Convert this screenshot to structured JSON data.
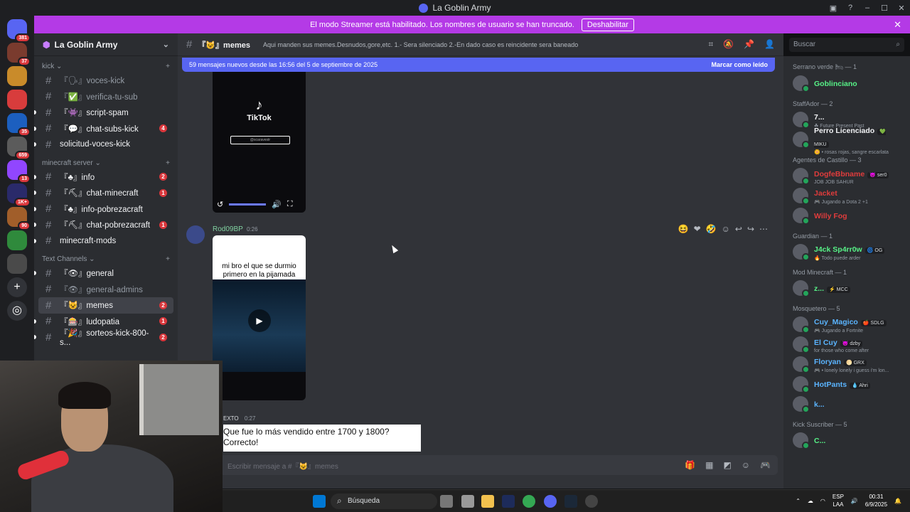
{
  "window": {
    "title": "La Goblin Army"
  },
  "servers": [
    {
      "icon": "discord-home-icon",
      "badge": "381",
      "color": "#5865f2"
    },
    {
      "icon": "server-icon",
      "badge": "37",
      "color": "#7a3b2e"
    },
    {
      "icon": "server-icon",
      "badge": "",
      "color": "#c98b2a"
    },
    {
      "icon": "server-icon",
      "badge": "",
      "color": "#d83c3c"
    },
    {
      "icon": "server-icon",
      "badge": "35",
      "color": "#1c5fbf"
    },
    {
      "icon": "server-icon",
      "badge": "659",
      "color": "#5b5b5b"
    },
    {
      "icon": "server-icon",
      "badge": "13",
      "color": "#9146ff"
    },
    {
      "icon": "server-icon",
      "badge": "1K+",
      "color": "#2a2a6a"
    },
    {
      "icon": "server-icon",
      "badge": "90",
      "color": "#a15e2a"
    },
    {
      "icon": "server-icon",
      "badge": "",
      "color": "#2f8a3c"
    },
    {
      "icon": "server-icon",
      "badge": "",
      "color": "#4a4a4a"
    }
  ],
  "banner": {
    "text": "El modo Streamer está habilitado. Los nombres de usuario se han truncado.",
    "button": "Deshabilitar",
    "close": "✕",
    "color": "#b43ae6"
  },
  "server": {
    "name": "La Goblin Army"
  },
  "categories": [
    {
      "label": "kick",
      "channels": [
        {
          "name": "『🗣』voces-kick",
          "unread": false,
          "count": ""
        },
        {
          "name": "『✅』verifica-tu-sub",
          "unread": false,
          "count": ""
        },
        {
          "name": "『👾』script-spam",
          "unread": true,
          "count": ""
        },
        {
          "name": "『💬』chat-subs-kick",
          "unread": true,
          "count": "4"
        },
        {
          "name": "solicitud-voces-kick",
          "unread": true,
          "count": ""
        }
      ]
    },
    {
      "label": "minecraft server",
      "channels": [
        {
          "name": "『♣』info",
          "unread": true,
          "count": "2"
        },
        {
          "name": "『⛏』chat-minecraft",
          "unread": true,
          "count": "1"
        },
        {
          "name": "『♣』info-pobrezacraft",
          "unread": true,
          "count": ""
        },
        {
          "name": "『⛏』chat-pobrezacraft",
          "unread": true,
          "count": "1"
        },
        {
          "name": "minecraft-mods",
          "unread": true,
          "count": ""
        }
      ]
    },
    {
      "label": "Text Channels",
      "channels": [
        {
          "name": "『👁』general",
          "unread": true,
          "count": ""
        },
        {
          "name": "『👁』general-admins",
          "unread": false,
          "count": ""
        },
        {
          "name": "『😺』memes",
          "unread": false,
          "count": "2",
          "active": true
        },
        {
          "name": "『🎰』ludopatia",
          "unread": true,
          "count": "1"
        },
        {
          "name": "『🎉』sorteos-kick-800-s...",
          "unread": true,
          "count": "2"
        }
      ]
    }
  ],
  "header": {
    "channel": "『😺』memes",
    "topic": "Aqui manden sus memes.Desnudos,gore,etc. 1.- Sera silenciado 2.-En dado caso es reincidente sera baneado",
    "search_placeholder": "Buscar"
  },
  "newbar": {
    "text": "59 mensajes nuevos desde las 16:56 del 5 de septiembre de 2025",
    "mark": "Marcar como leído"
  },
  "video1": {
    "brand": "TikTok",
    "handle": "@scaravestr"
  },
  "message2": {
    "author": "Rod09BP",
    "time": "0:26",
    "video_caption": "mi bro el que se durmio primero en la pijamada"
  },
  "message3": {
    "tag": "EXTO",
    "time": "0:27",
    "line1": "Que fue lo más vendido entre 1700 y 1800?",
    "line2": "Correcto!"
  },
  "composer": {
    "placeholder": "Escribir mensaje a #『😺』memes"
  },
  "member_groups": [
    {
      "label": "Serrano verde 🛏 — 1",
      "members": [
        {
          "name": "Goblinciano",
          "color": "#57f287",
          "status": "",
          "tag": ""
        }
      ]
    },
    {
      "label": "StaffAdor — 2",
      "members": [
        {
          "name": "7...",
          "color": "#f2f3f5",
          "status": "☘ Future Present Past",
          "tag": ""
        },
        {
          "name": "Perro Licenciado",
          "color": "#f2f3f5",
          "status": "🌼 • rosas rojas, sangre escarlata",
          "tag": "💚 MIKU"
        }
      ]
    },
    {
      "label": "Agentes de Castillo — 3",
      "members": [
        {
          "name": "DogfeBbname",
          "color": "#e03c3c",
          "status": "JOB JOB SAHUR",
          "tag": "😈 ser0"
        },
        {
          "name": "Jacket",
          "color": "#e03c3c",
          "status": "🎮 Jugando a Dota 2 +1",
          "tag": ""
        },
        {
          "name": "Willy Fog",
          "color": "#e03c3c",
          "status": "",
          "tag": ""
        }
      ]
    },
    {
      "label": "Guardian — 1",
      "members": [
        {
          "name": "J4ck Sp4rr0w",
          "color": "#57f287",
          "status": "🔥 Todo puede arder",
          "tag": "🌀 OG"
        }
      ]
    },
    {
      "label": "Mod Minecraft — 1",
      "members": [
        {
          "name": "z...",
          "color": "#57f287",
          "status": "",
          "tag": "⚡ MCC"
        }
      ]
    },
    {
      "label": "Mosquetero — 5",
      "members": [
        {
          "name": "Cuy_Magico",
          "color": "#5ab4ff",
          "status": "🎮 Jugando a Fortnite",
          "tag": "🍎 SDLG"
        },
        {
          "name": "El Cuy",
          "color": "#5ab4ff",
          "status": "for those who come after",
          "tag": "😈 dzby"
        },
        {
          "name": "Floryan",
          "color": "#5ab4ff",
          "status": "🎮 • lonely lonely i guess i'm lon...",
          "tag": "🌕 GRX"
        },
        {
          "name": "HotPants",
          "color": "#5ab4ff",
          "status": "",
          "tag": "💧 Ahri"
        },
        {
          "name": "k...",
          "color": "#5ab4ff",
          "status": "",
          "tag": ""
        }
      ]
    },
    {
      "label": "Kick Suscriber — 5",
      "members": [
        {
          "name": "C...",
          "color": "#57f287",
          "status": "",
          "tag": ""
        }
      ]
    }
  ],
  "taskbar": {
    "search": "Búsqueda",
    "lang": "ESP",
    "lang2": "LAA",
    "time": "00:31",
    "date": "6/9/2025"
  }
}
